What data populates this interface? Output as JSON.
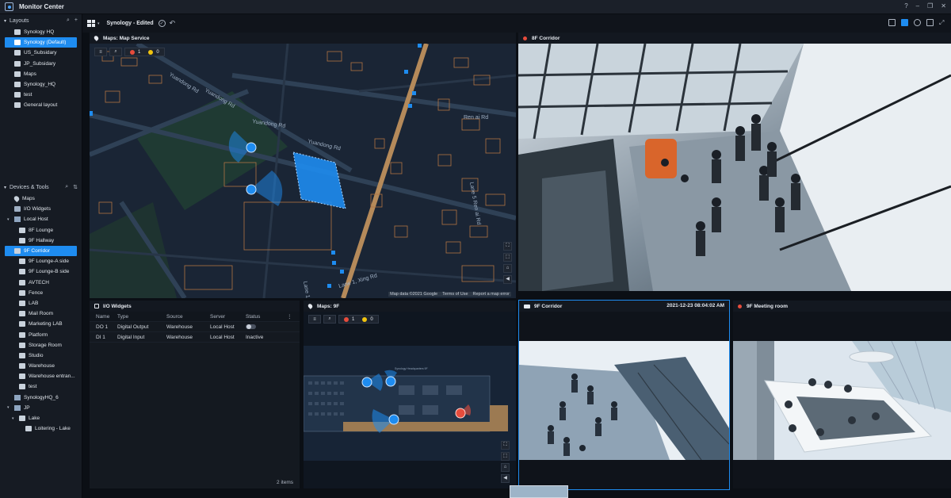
{
  "window": {
    "title": "Monitor Center"
  },
  "toolbar": {
    "layout_label": "Synology - Edited"
  },
  "sidebar": {
    "layouts_header": "Layouts",
    "layouts": [
      {
        "label": "Synology HQ"
      },
      {
        "label": "Synology (Default)",
        "selected": true
      },
      {
        "label": "US_Subsidary"
      },
      {
        "label": "JP_Subsidary"
      },
      {
        "label": "Maps"
      },
      {
        "label": "Synology_HQ"
      },
      {
        "label": "test"
      },
      {
        "label": "General layout"
      }
    ],
    "devices_header": "Devices & Tools",
    "devices": [
      {
        "label": "Maps",
        "icon": "pin-icon",
        "level": 1
      },
      {
        "label": "I/O Widgets",
        "icon": "io-icon",
        "level": 1
      },
      {
        "label": "Local Host",
        "icon": "host-icon",
        "level": 1,
        "expanded": true
      },
      {
        "label": "8F Lounge",
        "icon": "camera-icon",
        "level": 2
      },
      {
        "label": "9F Hallway",
        "icon": "camera-icon",
        "level": 2
      },
      {
        "label": "9F Corridor",
        "icon": "camera-icon",
        "level": 2,
        "selected": true
      },
      {
        "label": "9F Lounge-A side",
        "icon": "camera-icon",
        "level": 2
      },
      {
        "label": "9F Lounge-B side",
        "icon": "camera-icon",
        "level": 2
      },
      {
        "label": "AVTECH",
        "icon": "camera-icon",
        "level": 2
      },
      {
        "label": "Fence",
        "icon": "camera-icon",
        "level": 2
      },
      {
        "label": "LAB",
        "icon": "camera-icon",
        "level": 2
      },
      {
        "label": "Mail Room",
        "icon": "camera-icon",
        "level": 2
      },
      {
        "label": "Marketing LAB",
        "icon": "camera-icon",
        "level": 2
      },
      {
        "label": "Platform",
        "icon": "camera-icon",
        "level": 2
      },
      {
        "label": "Storage Room",
        "icon": "camera-icon",
        "level": 2
      },
      {
        "label": "Studio",
        "icon": "camera-icon",
        "level": 2
      },
      {
        "label": "Warehouse",
        "icon": "camera-icon",
        "level": 2
      },
      {
        "label": "Warehouse entran...",
        "icon": "camera-icon",
        "level": 2
      },
      {
        "label": "test",
        "icon": "camera-icon",
        "level": 2
      },
      {
        "label": "SynologyHQ_6",
        "icon": "host-icon",
        "level": 1
      },
      {
        "label": "JP",
        "icon": "host-icon",
        "level": 1,
        "expanded": true
      },
      {
        "label": "Lake",
        "icon": "folder-icon",
        "level": 2,
        "expanded": true
      },
      {
        "label": "Loitering - Lake",
        "icon": "camera-icon",
        "level": 3
      }
    ]
  },
  "panes": {
    "map_service": {
      "title": "Maps: Map Service",
      "alarm_red": "1",
      "alarm_yellow": "0",
      "attribution": [
        "Map data ©2021 Google",
        "Terms of Use",
        "Report a map error"
      ],
      "streets": [
        "Yuandong Rd",
        "Yuandong Rd",
        "Yuandong Rd",
        "Yuandong Rd",
        "Ren ai Rd",
        "Lane 1, Xing Rd",
        "Lane 5 Ren ai Rd",
        "Lane 1"
      ]
    },
    "corridor_8f": {
      "title": "8F Corridor"
    },
    "io_widgets": {
      "title": "I/O Widgets",
      "columns": [
        "Name",
        "Type",
        "Source",
        "Server",
        "Status"
      ],
      "rows": [
        {
          "name": "DO 1",
          "type": "Digital Output",
          "source": "Warehouse",
          "server": "Local Host",
          "status": ""
        },
        {
          "name": "DI 1",
          "type": "Digital Input",
          "source": "Warehouse",
          "server": "Local Host",
          "status": "Inactive"
        }
      ],
      "count": "2 items"
    },
    "map_9f": {
      "title": "Maps: 9F",
      "alarm_red": "1",
      "alarm_yellow": "0",
      "floor_label": "Synology Headquarters 9F"
    },
    "corridor_9f": {
      "title": "9F Corridor",
      "timestamp": "2021-12-23 08:04:02 AM"
    },
    "meeting_9f": {
      "title": "9F Meeting room"
    }
  },
  "colors": {
    "accent": "#1e8cf0",
    "alarm": "#e74c3c",
    "warning": "#f1c40f",
    "road": "#b58a5a"
  }
}
